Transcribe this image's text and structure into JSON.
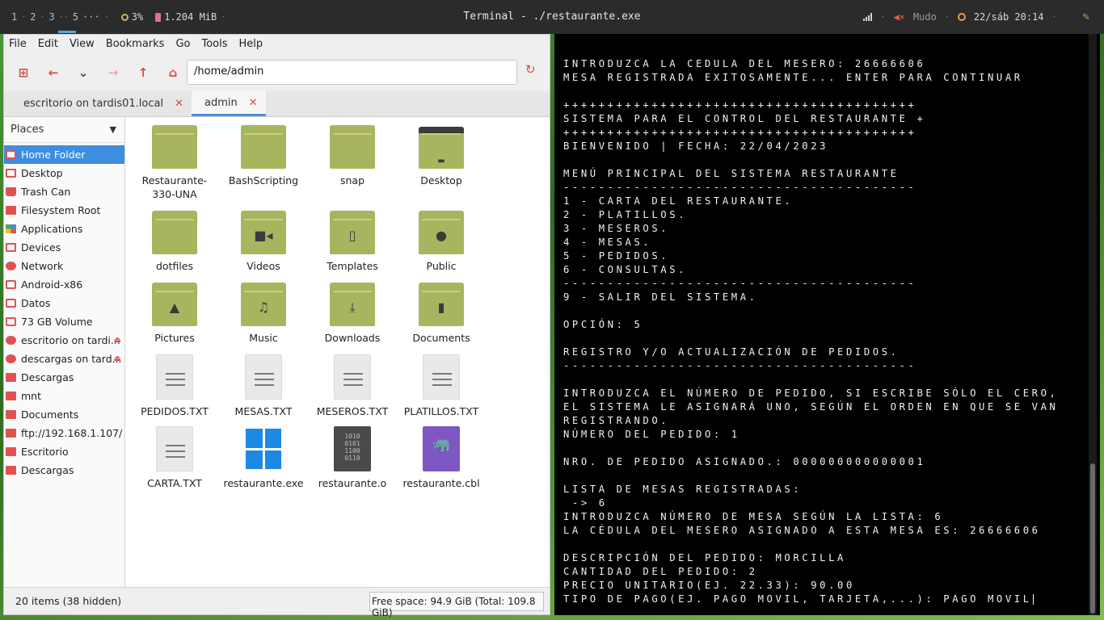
{
  "topbar": {
    "workspaces": [
      "1",
      "2",
      "3",
      "5",
      "···"
    ],
    "cpu": "3%",
    "memory": "1.204 MiB",
    "window_title": "Terminal - ./restaurante.exe",
    "volume": "Mudo",
    "clock": "22/sáb 20:14"
  },
  "file_manager": {
    "menu": [
      "File",
      "Edit",
      "View",
      "Bookmarks",
      "Go",
      "Tools",
      "Help"
    ],
    "location": "/home/admin",
    "tabs": [
      {
        "label": "escritorio on tardis01.local"
      },
      {
        "label": "admin"
      }
    ],
    "places_label": "Places",
    "sidebar": [
      {
        "label": "Home Folder",
        "icon": "home-icon"
      },
      {
        "label": "Desktop",
        "icon": "desktop-icon"
      },
      {
        "label": "Trash Can",
        "icon": "trash-icon"
      },
      {
        "label": "Filesystem Root",
        "icon": "folder-icon"
      },
      {
        "label": "Applications",
        "icon": "apps-icon"
      },
      {
        "label": "Devices",
        "icon": "devices-icon"
      },
      {
        "label": "Network",
        "icon": "network-icon"
      },
      {
        "label": "Android-x86",
        "icon": "drive-icon"
      },
      {
        "label": "Datos",
        "icon": "drive-icon"
      },
      {
        "label": "73 GB Volume",
        "icon": "drive-icon"
      },
      {
        "label": "escritorio on tardi...",
        "icon": "network-share-icon"
      },
      {
        "label": "descargas on tard...",
        "icon": "network-share-icon"
      },
      {
        "label": "Descargas",
        "icon": "folder-icon"
      },
      {
        "label": "mnt",
        "icon": "folder-icon"
      },
      {
        "label": "Documents",
        "icon": "folder-icon"
      },
      {
        "label": "ftp://192.168.1.107/",
        "icon": "folder-icon"
      },
      {
        "label": "Escritorio",
        "icon": "folder-icon"
      },
      {
        "label": "Descargas",
        "icon": "folder-icon"
      }
    ],
    "files": [
      {
        "name": "Restaurante-330-UNA",
        "type": "folder"
      },
      {
        "name": "BashScripting",
        "type": "folder"
      },
      {
        "name": "snap",
        "type": "folder"
      },
      {
        "name": "Desktop",
        "type": "desktop"
      },
      {
        "name": "dotfiles",
        "type": "folder"
      },
      {
        "name": "Videos",
        "type": "folder-videos"
      },
      {
        "name": "Templates",
        "type": "folder-templates"
      },
      {
        "name": "Public",
        "type": "folder-public"
      },
      {
        "name": "Pictures",
        "type": "folder-pictures"
      },
      {
        "name": "Music",
        "type": "folder-music"
      },
      {
        "name": "Downloads",
        "type": "folder-downloads"
      },
      {
        "name": "Documents",
        "type": "folder-documents"
      },
      {
        "name": "PEDIDOS.TXT",
        "type": "text"
      },
      {
        "name": "MESAS.TXT",
        "type": "text"
      },
      {
        "name": "MESEROS.TXT",
        "type": "text"
      },
      {
        "name": "PLATILLOS.TXT",
        "type": "text"
      },
      {
        "name": "CARTA.TXT",
        "type": "text"
      },
      {
        "name": "restaurante.exe",
        "type": "exe"
      },
      {
        "name": "restaurante.o",
        "type": "object"
      },
      {
        "name": "restaurante.cbl",
        "type": "cobol"
      }
    ],
    "status_items": "20 items (38 hidden)",
    "status_space": "Free space: 94.9 GiB (Total: 109.8 GiB)"
  },
  "terminal": {
    "lines": [
      "INTRODUZCA LA CEDULA DEL MESERO: 26666606",
      "MESA REGISTRADA EXITOSAMENTE... ENTER PARA CONTINUAR",
      "",
      "++++++++++++++++++++++++++++++++++++++++",
      "SISTEMA PARA EL CONTROL DEL RESTAURANTE +",
      "++++++++++++++++++++++++++++++++++++++++",
      "BIENVENIDO | FECHA: 22/04/2023",
      "",
      "MENÚ PRINCIPAL DEL SISTEMA RESTAURANTE",
      "----------------------------------------",
      "1 - CARTA DEL RESTAURANTE.",
      "2 - PLATILLOS.",
      "3 - MESEROS.",
      "4 - MESAS.",
      "5 - PEDIDOS.",
      "6 - CONSULTAS.",
      "----------------------------------------",
      "9 - SALIR DEL SISTEMA.",
      "",
      "OPCIÓN: 5",
      "",
      "REGISTRO Y/O ACTUALIZACIÓN DE PEDIDOS.",
      "----------------------------------------",
      "",
      "INTRODUZCA EL NÚMERO DE PEDIDO, SI ESCRIBE SÓLO EL CERO,",
      "EL SISTEMA LE ASIGNARÁ UNO, SEGÚN EL ORDEN EN QUE SE VAN",
      "REGISTRANDO.",
      "NÚMERO DEL PEDIDO: 1",
      "",
      "NRO. DE PEDIDO ASIGNADO.: 000000000000001",
      "",
      "LISTA DE MESAS REGISTRADAS:",
      " -> 6",
      "INTRODUZCA NÚMERO DE MESA SEGÚN LA LISTA: 6",
      "LA CÉDULA DEL MESERO ASIGNADO A ESTA MESA ES: 26666606",
      "",
      "DESCRIPCIÓN DEL PEDIDO: MORCILLA",
      "CANTIDAD DEL PEDIDO: 2",
      "PRECIO UNITARIO(EJ. 22.33): 90.00",
      "TIPO DE PAGO(EJ. PAGO MOVIL, TARJETA,...): PAGO MOVIL"
    ]
  }
}
